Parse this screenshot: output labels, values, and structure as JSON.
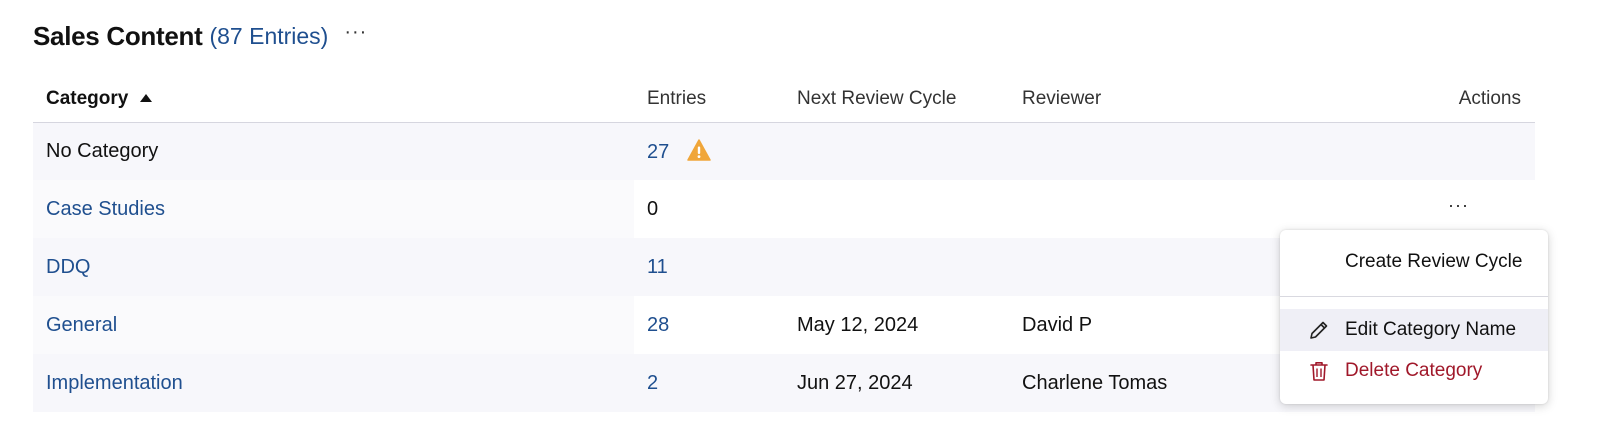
{
  "header": {
    "title": "Sales Content",
    "count_label": "(87 Entries)",
    "more_label": "···"
  },
  "table": {
    "columns": {
      "category": "Category",
      "entries": "Entries",
      "next_review": "Next Review Cycle",
      "reviewer": "Reviewer",
      "actions": "Actions"
    },
    "sort": {
      "column": "category",
      "direction": "ascending"
    },
    "rows": [
      {
        "category": "No Category",
        "entries": "27",
        "next_review": "",
        "reviewer": "",
        "warning": true,
        "actions": ""
      },
      {
        "category": "Case Studies",
        "entries": "0",
        "next_review": "",
        "reviewer": "",
        "warning": false,
        "actions": "···"
      },
      {
        "category": "DDQ",
        "entries": "11",
        "next_review": "",
        "reviewer": "",
        "warning": false,
        "actions": ""
      },
      {
        "category": "General",
        "entries": "28",
        "next_review": "May 12, 2024",
        "reviewer": "David P",
        "warning": false,
        "actions": ""
      },
      {
        "category": "Implementation",
        "entries": "2",
        "next_review": "Jun 27, 2024",
        "reviewer": "Charlene Tomas",
        "warning": false,
        "actions": ""
      }
    ]
  },
  "context_menu": {
    "items": [
      {
        "label": "Create Review Cycle",
        "icon": ""
      },
      {
        "label": "Edit Category Name",
        "icon": "pencil-icon"
      },
      {
        "label": "Delete Category",
        "icon": "trash-icon"
      }
    ]
  },
  "colors": {
    "link": "#1f4f8f",
    "warning": "#f0a63a",
    "danger": "#a0182a",
    "row_shade": "#f7f7fb",
    "menu_highlight": "#efeff6"
  }
}
